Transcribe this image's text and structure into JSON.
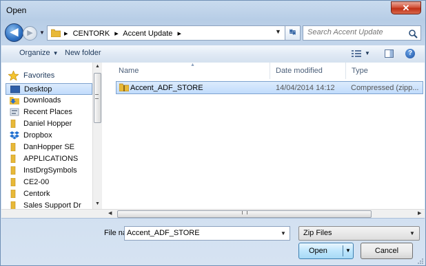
{
  "window": {
    "title": "Open",
    "close_glyph": "✕"
  },
  "nav": {
    "back_glyph": "◀",
    "forward_glyph": "▶",
    "breadcrumb": [
      "▸",
      "CENTORK",
      "▸",
      "Accent Update",
      "▸"
    ],
    "search_placeholder": "Search Accent Update"
  },
  "toolbar": {
    "organize_label": "Organize",
    "new_folder_label": "New folder",
    "help_glyph": "?"
  },
  "sidebar": {
    "favorites_label": "Favorites",
    "items": [
      {
        "label": "Desktop",
        "icon": "desktop-icon",
        "selected": true
      },
      {
        "label": "Downloads",
        "icon": "downloads-icon"
      },
      {
        "label": "Recent Places",
        "icon": "recent-places-icon"
      },
      {
        "label": "Daniel Hopper",
        "icon": "folder-icon"
      },
      {
        "label": "Dropbox",
        "icon": "dropbox-icon"
      },
      {
        "label": "DanHopper SE",
        "icon": "folder-icon"
      },
      {
        "label": "APPLICATIONS",
        "icon": "folder-icon"
      },
      {
        "label": "InstDrgSymbols",
        "icon": "folder-icon"
      },
      {
        "label": "CE2-00",
        "icon": "folder-icon"
      },
      {
        "label": "Centork",
        "icon": "folder-icon"
      },
      {
        "label": "Sales Support Dr",
        "icon": "folder-icon"
      }
    ]
  },
  "file_list": {
    "columns": [
      "Name",
      "Date modified",
      "Type"
    ],
    "rows": [
      {
        "name": "Accent_ADF_STORE",
        "date": "14/04/2014 14:12",
        "type": "Compressed (zipp..."
      }
    ]
  },
  "bottom": {
    "file_name_label": "File name:",
    "file_name_value": "Accent_ADF_STORE",
    "file_type_value": "Zip Files",
    "open_label": "Open",
    "cancel_label": "Cancel"
  },
  "colors": {
    "accent": "#3c7fb1",
    "selection": "#c1dcfc",
    "folder": "#e8b938"
  }
}
